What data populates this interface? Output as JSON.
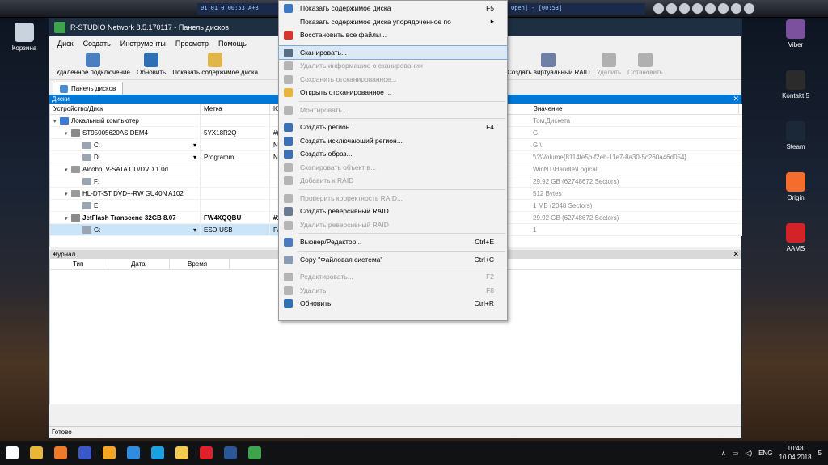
{
  "player": {
    "lcd_left": "01   01   0:00:53   A+B",
    "lcd_right": "Open] - [00:53]"
  },
  "desktop_left": [
    {
      "label": "Корзина"
    }
  ],
  "desktop_right": [
    {
      "label": "Viber",
      "color": "#7b519d"
    },
    {
      "label": "Kontakt 5",
      "color": "#2b2b2b"
    },
    {
      "label": "Steam",
      "color": "#1b2838"
    },
    {
      "label": "Origin",
      "color": "#f56c2d"
    },
    {
      "label": "AAMS",
      "color": "#d2232a"
    }
  ],
  "window": {
    "title": "R-STUDIO Network 8.5.170117 - Панель дисков",
    "menu": [
      "Диск",
      "Создать",
      "Инструменты",
      "Просмотр",
      "Помощь"
    ],
    "toolbar": [
      {
        "label": "Удаленное подключение",
        "icon": "remote-connect-icon",
        "color": "#4a7fc1",
        "disabled": false
      },
      {
        "label": "Обновить",
        "icon": "refresh-icon",
        "color": "#2f6fb5",
        "disabled": false
      },
      {
        "label": "Показать содержимое диска",
        "icon": "folder-icon",
        "color": "#e0b64a",
        "disabled": false
      }
    ],
    "toolbar_right": [
      {
        "label": "Создать виртуальный RAID",
        "icon": "raid-icon",
        "color": "#6f7fa6",
        "disabled": false
      },
      {
        "label": "Удалить",
        "icon": "delete-icon",
        "color": "#b0b0b0",
        "disabled": true
      },
      {
        "label": "Остановить",
        "icon": "stop-icon",
        "color": "#b0b0b0",
        "disabled": true
      }
    ],
    "tab": "Панель дисков",
    "disks_header": "Диски",
    "columns": [
      "Устройство/Диск",
      "Метка",
      "Ю"
    ],
    "value_column": "Значение",
    "rows": [
      {
        "indent": 0,
        "name": "Локальный компьютер",
        "label": "",
        "fs": "",
        "icon": "computer-icon",
        "color": "#3b7dd8",
        "bold": false
      },
      {
        "indent": 1,
        "name": "ST95005620AS DEM4",
        "label": "5YX18R2Q",
        "fs": "#(",
        "icon": "hdd-icon",
        "color": "#8a8a8a",
        "bold": false
      },
      {
        "indent": 2,
        "name": "C:",
        "label": "",
        "fs": "N",
        "icon": "partition-icon",
        "color": "#9aa5b1",
        "bold": false,
        "dropdown": true
      },
      {
        "indent": 2,
        "name": "D:",
        "label": "Programm",
        "fs": "N",
        "icon": "partition-icon",
        "color": "#9aa5b1",
        "bold": false,
        "dropdown": true
      },
      {
        "indent": 1,
        "name": "Alcohol V-SATA CD/DVD 1.0d",
        "label": "",
        "fs": "",
        "icon": "cd-icon",
        "color": "#9a9a9a",
        "bold": false
      },
      {
        "indent": 2,
        "name": "F:",
        "label": "",
        "fs": "",
        "icon": "partition-icon",
        "color": "#9aa5b1",
        "bold": false
      },
      {
        "indent": 1,
        "name": "HL-DT-ST DVD+-RW GU40N A102",
        "label": "",
        "fs": "",
        "icon": "cd-icon",
        "color": "#9a9a9a",
        "bold": false
      },
      {
        "indent": 2,
        "name": "E:",
        "label": "",
        "fs": "",
        "icon": "partition-icon",
        "color": "#9aa5b1",
        "bold": false
      },
      {
        "indent": 1,
        "name": "JetFlash Transcend 32GB 8.07",
        "label": "FW4XQQBU",
        "fs": "#1",
        "icon": "usb-icon",
        "color": "#8a8a8a",
        "bold": true
      },
      {
        "indent": 2,
        "name": "G:",
        "label": "ESD-USB",
        "fs": "FA",
        "icon": "partition-icon",
        "color": "#9aa5b1",
        "bold": false,
        "dropdown": true,
        "selected": true
      }
    ],
    "values": [
      "Том,Дискета",
      "G:",
      "G:\\",
      "\\\\?\\Volume{8114fe5b-f2eb-11e7-8a30-5c260a46d054}",
      "WinNT\\Handle\\Logical",
      "29.92 GB (62748672 Sectors)",
      "512 Bytes",
      "1 MB (2048 Sectors)",
      "29.92 GB (62748672 Sectors)",
      "1"
    ],
    "log_header": "Журнал",
    "log_columns": [
      "Тип",
      "Дата",
      "Время"
    ],
    "status": "Готово"
  },
  "context_menu": [
    {
      "type": "item",
      "label": "Показать содержимое диска",
      "shortcut": "F5",
      "icon": "folder-view-icon",
      "color": "#3b78c4",
      "disabled": false
    },
    {
      "type": "item",
      "label": "Показать содержимое диска упорядоченное по",
      "shortcut": "▸",
      "icon": "",
      "color": "",
      "disabled": false
    },
    {
      "type": "item",
      "label": "Восстановить все файлы...",
      "shortcut": "",
      "icon": "recover-icon",
      "color": "#d9342b",
      "disabled": false
    },
    {
      "type": "sep"
    },
    {
      "type": "item",
      "label": "Сканировать...",
      "shortcut": "",
      "icon": "scan-icon",
      "color": "#5a6d85",
      "disabled": false,
      "highlight": true
    },
    {
      "type": "item",
      "label": "Удалить информацию о сканировании",
      "shortcut": "",
      "icon": "delete-scan-icon",
      "color": "#b5b5b5",
      "disabled": true
    },
    {
      "type": "item",
      "label": "Сохранить отсканированное...",
      "shortcut": "",
      "icon": "save-scan-icon",
      "color": "#b5b5b5",
      "disabled": true
    },
    {
      "type": "item",
      "label": "Открыть отсканированное ...",
      "shortcut": "",
      "icon": "open-scan-icon",
      "color": "#e7b53a",
      "disabled": false
    },
    {
      "type": "sep"
    },
    {
      "type": "item",
      "label": "Монтировать...",
      "shortcut": "",
      "icon": "mount-icon",
      "color": "#b5b5b5",
      "disabled": true
    },
    {
      "type": "sep"
    },
    {
      "type": "item",
      "label": "Создать регион...",
      "shortcut": "F4",
      "icon": "region-icon",
      "color": "#3b6fb6",
      "disabled": false
    },
    {
      "type": "item",
      "label": "Создать исключающий регион...",
      "shortcut": "",
      "icon": "exclude-region-icon",
      "color": "#3b6fb6",
      "disabled": false
    },
    {
      "type": "item",
      "label": "Создать образ...",
      "shortcut": "",
      "icon": "image-icon",
      "color": "#3b6fb6",
      "disabled": false
    },
    {
      "type": "item",
      "label": "Скопировать объект в...",
      "shortcut": "",
      "icon": "copy-object-icon",
      "color": "#b5b5b5",
      "disabled": true
    },
    {
      "type": "item",
      "label": "Добавить к RAID",
      "shortcut": "",
      "icon": "add-raid-icon",
      "color": "#b5b5b5",
      "disabled": true
    },
    {
      "type": "sep"
    },
    {
      "type": "item",
      "label": "Проверить корректность RAID...",
      "shortcut": "",
      "icon": "check-raid-icon",
      "color": "#b5b5b5",
      "disabled": true
    },
    {
      "type": "item",
      "label": "Создать реверсивный RAID",
      "shortcut": "",
      "icon": "reverse-raid-icon",
      "color": "#6a7a92",
      "disabled": false
    },
    {
      "type": "item",
      "label": "Удалить реверсивный RAID",
      "shortcut": "",
      "icon": "remove-reverse-raid-icon",
      "color": "#b5b5b5",
      "disabled": true
    },
    {
      "type": "sep"
    },
    {
      "type": "item",
      "label": "Вьювер/Редактор...",
      "shortcut": "Ctrl+E",
      "icon": "hex-editor-icon",
      "color": "#4b7bbf",
      "disabled": false
    },
    {
      "type": "sep"
    },
    {
      "type": "item",
      "label": "Copy \"Файловая система\"",
      "shortcut": "Ctrl+C",
      "icon": "copy-icon",
      "color": "#8a9bb4",
      "disabled": false
    },
    {
      "type": "sep"
    },
    {
      "type": "item",
      "label": "Редактировать...",
      "shortcut": "F2",
      "icon": "edit-icon",
      "color": "#b5b5b5",
      "disabled": true
    },
    {
      "type": "item",
      "label": "Удалить",
      "shortcut": "F8",
      "icon": "delete-icon",
      "color": "#b5b5b5",
      "disabled": true
    },
    {
      "type": "item",
      "label": "Обновить",
      "shortcut": "Ctrl+R",
      "icon": "refresh-icon",
      "color": "#2f6fb5",
      "disabled": false
    }
  ],
  "taskbar": {
    "apps": [
      {
        "icon": "start-icon",
        "color": "#ffffff"
      },
      {
        "icon": "chrome-icon",
        "color": "#e8b73a"
      },
      {
        "icon": "fl-studio-icon",
        "color": "#f07a2a"
      },
      {
        "icon": "launcher-icon",
        "color": "#3a58c8"
      },
      {
        "icon": "fruity-icon",
        "color": "#f5a623"
      },
      {
        "icon": "ccleaner-icon",
        "color": "#2e8de0"
      },
      {
        "icon": "teamviewer-icon",
        "color": "#1ba0e2"
      },
      {
        "icon": "explorer-icon",
        "color": "#f3c94e"
      },
      {
        "icon": "opera-icon",
        "color": "#e0202a"
      },
      {
        "icon": "word-icon",
        "color": "#2b5797"
      },
      {
        "icon": "rstudio-icon",
        "color": "#3fa34d"
      }
    ],
    "lang": "ENG",
    "time": "10:48",
    "date": "10.04.2018",
    "notif": "5"
  }
}
